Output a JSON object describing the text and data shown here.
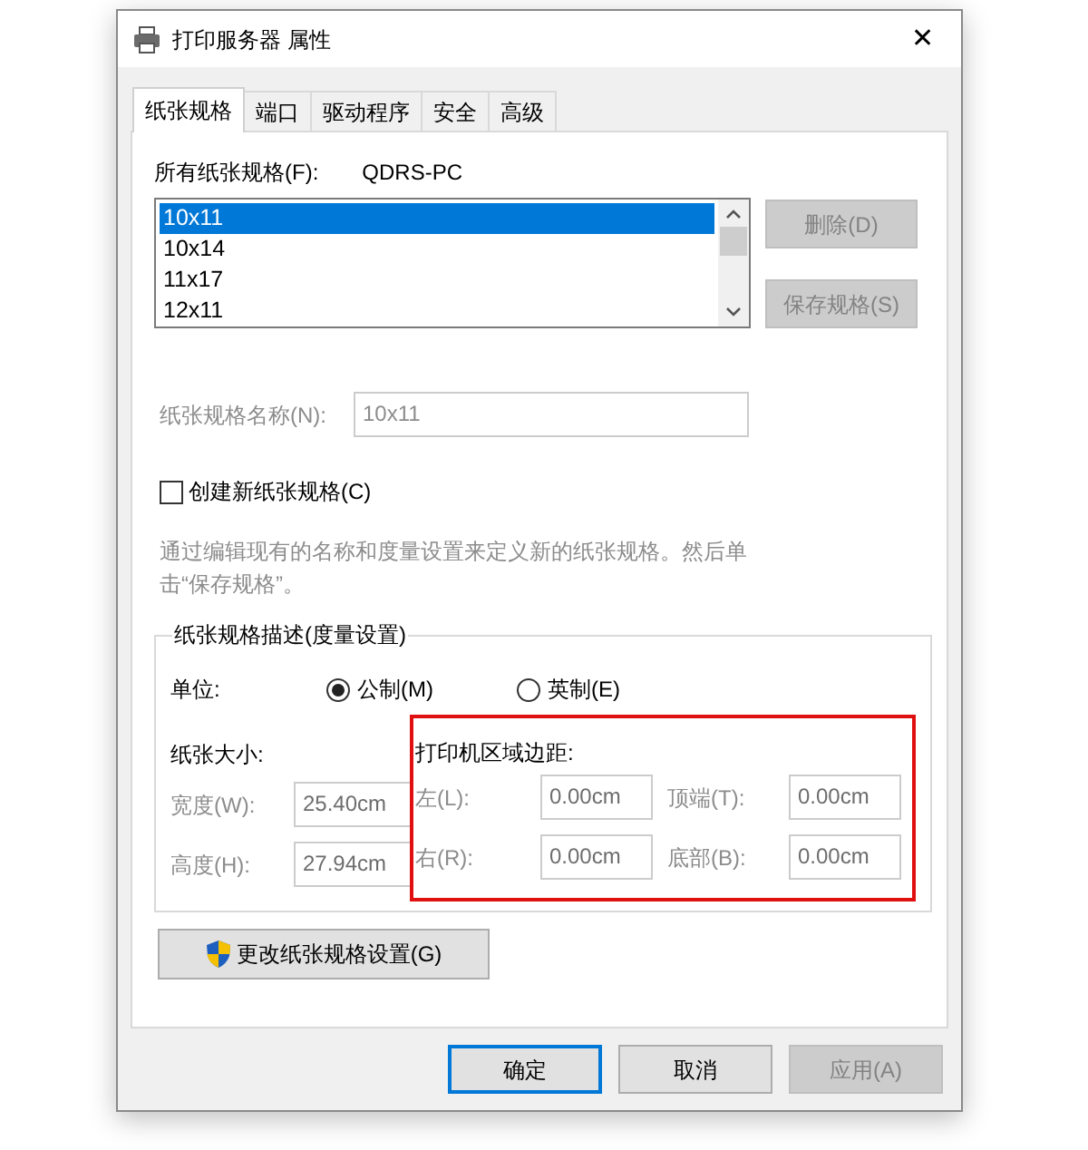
{
  "window": {
    "title": "打印服务器 属性",
    "close": "✕"
  },
  "tabs": [
    {
      "label": "纸张规格",
      "selected": true
    },
    {
      "label": "端口",
      "selected": false
    },
    {
      "label": "驱动程序",
      "selected": false
    },
    {
      "label": "安全",
      "selected": false
    },
    {
      "label": "高级",
      "selected": false
    }
  ],
  "forms_list": {
    "label": "所有纸张规格(F):",
    "server": "QDRS-PC",
    "items": [
      {
        "text": "10x11",
        "selected": true
      },
      {
        "text": "10x14",
        "selected": false
      },
      {
        "text": "11x17",
        "selected": false
      },
      {
        "text": "12x11",
        "selected": false
      }
    ]
  },
  "side_buttons": [
    {
      "label": "删除(D)",
      "disabled": true
    },
    {
      "label": "保存规格(S)",
      "disabled": true
    }
  ],
  "form_name": {
    "label": "纸张规格名称(N):",
    "value": "10x11",
    "disabled": true
  },
  "create_checkbox": {
    "label": "创建新纸张规格(C)",
    "checked": false
  },
  "description": "通过编辑现有的名称和度量设置来定义新的纸张规格。然后单击“保存规格”。",
  "measurements": {
    "legend": "纸张规格描述(度量设置)",
    "units": {
      "label": "单位:",
      "options": [
        {
          "label": "公制(M)",
          "selected": true
        },
        {
          "label": "英制(E)",
          "selected": false
        }
      ]
    },
    "paper_size": {
      "title": "纸张大小:",
      "fields": [
        {
          "label": "宽度(W):",
          "value": "25.40cm"
        },
        {
          "label": "高度(H):",
          "value": "27.94cm"
        }
      ]
    },
    "margins": {
      "title": "打印机区域边距:",
      "highlighted": true,
      "fields": [
        {
          "label": "左(L):",
          "value": "0.00cm"
        },
        {
          "label": "顶端(T):",
          "value": "0.00cm"
        },
        {
          "label": "右(R):",
          "value": "0.00cm"
        },
        {
          "label": "底部(B):",
          "value": "0.00cm"
        }
      ]
    }
  },
  "change_button": {
    "label": "更改纸张规格设置(G)"
  },
  "footer_buttons": [
    {
      "label": "确定",
      "kind": "default",
      "disabled": false
    },
    {
      "label": "取消",
      "kind": "normal",
      "disabled": false
    },
    {
      "label": "应用(A)",
      "kind": "normal",
      "disabled": true
    }
  ]
}
